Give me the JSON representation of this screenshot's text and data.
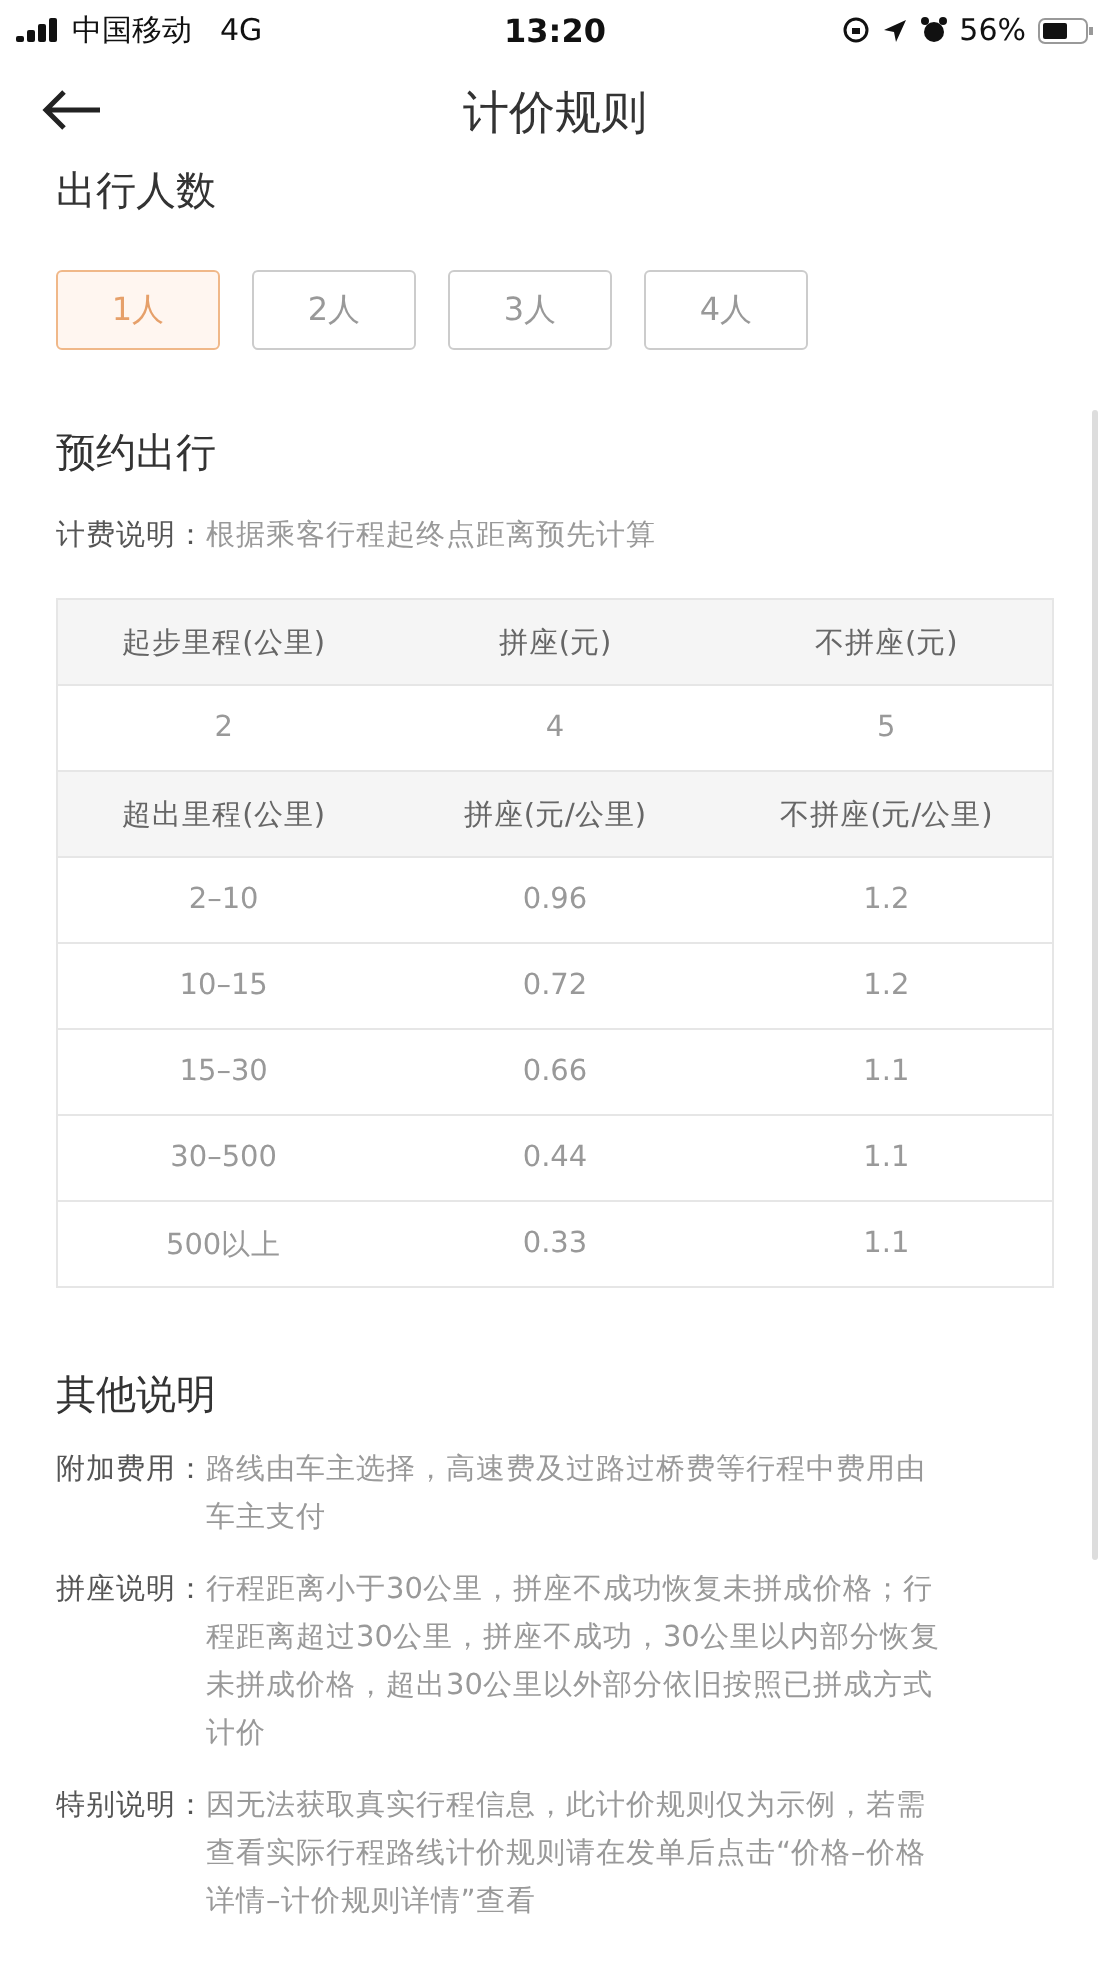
{
  "status_bar": {
    "carrier": "中国移动",
    "network": "4G",
    "time": "13:20",
    "battery": "56%"
  },
  "nav": {
    "title": "计价规则"
  },
  "passengers": {
    "title": "出行人数",
    "options": [
      {
        "label": "1人",
        "selected": true
      },
      {
        "label": "2人",
        "selected": false
      },
      {
        "label": "3人",
        "selected": false
      },
      {
        "label": "4人",
        "selected": false
      }
    ]
  },
  "booking": {
    "title": "预约出行",
    "note_label": "计费说明：",
    "note": "根据乘客行程起终点距离预先计算",
    "table": {
      "rows": [
        {
          "kind": "header",
          "cells": [
            "起步里程(公里)",
            "拼座(元)",
            "不拼座(元)"
          ]
        },
        {
          "kind": "data",
          "cells": [
            "2",
            "4",
            "5"
          ]
        },
        {
          "kind": "header",
          "cells": [
            "超出里程(公里)",
            "拼座(元/公里)",
            "不拼座(元/公里)"
          ]
        },
        {
          "kind": "data",
          "cells": [
            "2–10",
            "0.96",
            "1.2"
          ]
        },
        {
          "kind": "data",
          "cells": [
            "10–15",
            "0.72",
            "1.2"
          ]
        },
        {
          "kind": "data",
          "cells": [
            "15–30",
            "0.66",
            "1.1"
          ]
        },
        {
          "kind": "data",
          "cells": [
            "30–500",
            "0.44",
            "1.1"
          ]
        },
        {
          "kind": "data",
          "cells": [
            "500以上",
            "0.33",
            "1.1"
          ]
        }
      ]
    }
  },
  "other": {
    "title": "其他说明",
    "items": [
      {
        "label": "附加费用：",
        "text": "路线由车主选择，高速费及过路过桥费等行程中费用由车主支付"
      },
      {
        "label": "拼座说明：",
        "text": "行程距离小于30公里，拼座不成功恢复未拼成价格；行程距离超过30公里，拼座不成功，30公里以内部分恢复未拼成价格，超出30公里以外部分依旧按照已拼成方式计价"
      },
      {
        "label": "特别说明：",
        "text": "因无法获取真实行程信息，此计价规则仅为示例，若需查看实际行程路线计价规则请在发单后点击“价格–价格详情–计价规则详情”查看"
      }
    ]
  }
}
